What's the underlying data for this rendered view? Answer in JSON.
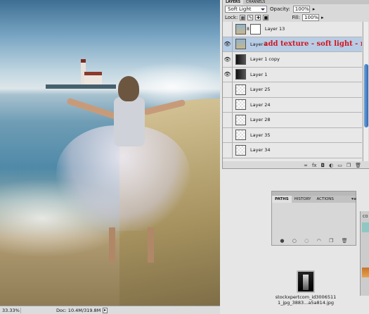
{
  "status_bar": {
    "zoom": "33.33%",
    "doc": "Doc: 10.4M/319.8M",
    "arrow": "▸"
  },
  "layers_panel": {
    "tabs": [
      "LAYERS",
      "CHANNELS"
    ],
    "blend_mode": "Soft Light",
    "opacity_label": "Opacity:",
    "opacity_value": "100%",
    "lock_label": "Lock:",
    "fill_label": "Fill:",
    "fill_value": "100%",
    "layers": [
      {
        "name": "Layer 13",
        "visible": false
      },
      {
        "name": "Layer 2",
        "visible": true,
        "selected": true
      },
      {
        "name": "Layer 1 copy",
        "visible": true
      },
      {
        "name": "Layer 1",
        "visible": true
      },
      {
        "name": "Layer 25",
        "visible": false
      },
      {
        "name": "Layer 24",
        "visible": false
      },
      {
        "name": "Layer 28",
        "visible": false
      },
      {
        "name": "Layer 35",
        "visible": false
      },
      {
        "name": "Layer 34",
        "visible": false
      }
    ],
    "annotation": "add texture - soft light - mask",
    "bottom_icons": [
      "link-icon",
      "fx-icon",
      "mask-icon",
      "adjustment-icon",
      "group-icon",
      "new-layer-icon",
      "trash-icon"
    ]
  },
  "paths_panel": {
    "tabs": [
      "PATHS",
      "HISTORY",
      "ACTIONS"
    ],
    "menu": "▾≡",
    "bottom_icons": [
      "fill-path-icon",
      "stroke-path-icon",
      "load-selection-icon",
      "make-path-icon",
      "new-path-icon",
      "trash-icon"
    ]
  },
  "file_icon": {
    "name_line1": "stockxpertcom_id3006511",
    "name_line2": "1_jpg_3883...a5a814.jpg"
  },
  "colors": {
    "selected_layer": "#b7cde6",
    "annotation": "#d3151c",
    "scroll": "#2f6bb3"
  }
}
